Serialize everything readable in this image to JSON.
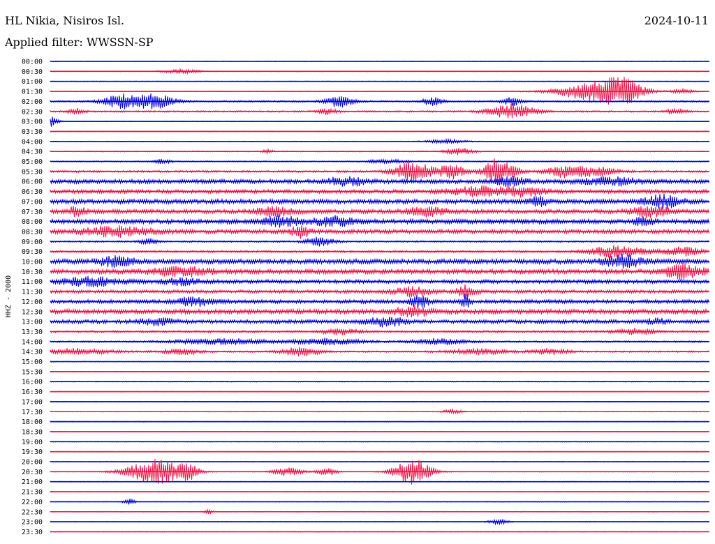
{
  "header": {
    "station": "HL Nikia, Nisiros Isl.",
    "date": "2024-10-11",
    "filter": "Applied filter: WWSSN-SP"
  },
  "chart_data": {
    "type": "line",
    "title": "HL Nikia, Nisiros Isl.",
    "ylabel": "HHZ - 2000",
    "colors": [
      "#0000dd",
      "#ee1144"
    ],
    "rows": [
      {
        "time": "00:00",
        "activity": 1
      },
      {
        "time": "00:30",
        "activity": 1,
        "bursts": [
          [
            0.2,
            1.5,
            0.02
          ]
        ]
      },
      {
        "time": "01:00",
        "activity": 1
      },
      {
        "time": "01:30",
        "activity": 1,
        "bursts": [
          [
            0.83,
            7,
            0.04
          ],
          [
            0.87,
            6,
            0.02
          ],
          [
            0.96,
            2,
            0.01
          ]
        ]
      },
      {
        "time": "02:00",
        "activity": 2,
        "bursts": [
          [
            0.11,
            5,
            0.02
          ],
          [
            0.16,
            5,
            0.02
          ],
          [
            0.44,
            4,
            0.015
          ],
          [
            0.58,
            3,
            0.01
          ],
          [
            0.7,
            3,
            0.01
          ]
        ]
      },
      {
        "time": "02:30",
        "activity": 2,
        "bursts": [
          [
            0.04,
            2,
            0.01
          ],
          [
            0.7,
            5,
            0.025
          ],
          [
            0.42,
            2,
            0.01
          ],
          [
            0.95,
            2,
            0.01
          ]
        ]
      },
      {
        "time": "03:00",
        "activity": 1,
        "bursts": [
          [
            0.0,
            4,
            0.008
          ]
        ]
      },
      {
        "time": "03:30",
        "activity": 1
      },
      {
        "time": "04:00",
        "activity": 1,
        "bursts": [
          [
            0.6,
            1.5,
            0.02
          ]
        ]
      },
      {
        "time": "04:30",
        "activity": 1.3,
        "bursts": [
          [
            0.62,
            2.5,
            0.015
          ],
          [
            0.33,
            1.5,
            0.005
          ]
        ]
      },
      {
        "time": "05:00",
        "activity": 1.5,
        "bursts": [
          [
            0.17,
            1.5,
            0.01
          ],
          [
            0.51,
            1.5,
            0.02
          ]
        ]
      },
      {
        "time": "05:30",
        "activity": 2.5,
        "bursts": [
          [
            0.55,
            7,
            0.02
          ],
          [
            0.61,
            5,
            0.015
          ],
          [
            0.67,
            6,
            0.01
          ],
          [
            0.69,
            6,
            0.015
          ],
          [
            0.78,
            4,
            0.02
          ],
          [
            0.83,
            3,
            0.02
          ]
        ]
      },
      {
        "time": "06:00",
        "activity": 5,
        "bursts": [
          [
            0.45,
            3,
            0.02
          ],
          [
            0.7,
            3,
            0.015
          ],
          [
            0.85,
            2.5,
            0.03
          ]
        ]
      },
      {
        "time": "06:30",
        "activity": 4.5,
        "bursts": [
          [
            0.65,
            3,
            0.03
          ],
          [
            0.72,
            3,
            0.02
          ]
        ]
      },
      {
        "time": "07:00",
        "activity": 5.5,
        "bursts": [
          [
            0.93,
            4,
            0.02
          ],
          [
            0.74,
            3,
            0.01
          ]
        ]
      },
      {
        "time": "07:30",
        "activity": 5,
        "bursts": [
          [
            0.04,
            3,
            0.01
          ],
          [
            0.34,
            3,
            0.02
          ],
          [
            0.57,
            3,
            0.02
          ],
          [
            0.91,
            4,
            0.02
          ]
        ]
      },
      {
        "time": "08:00",
        "activity": 5.5,
        "bursts": [
          [
            0.35,
            3,
            0.02
          ],
          [
            0.43,
            3,
            0.02
          ],
          [
            0.9,
            3,
            0.01
          ]
        ]
      },
      {
        "time": "08:30",
        "activity": 5,
        "bursts": [
          [
            0.1,
            3,
            0.04
          ],
          [
            0.38,
            4,
            0.01
          ]
        ]
      },
      {
        "time": "09:00",
        "activity": 2,
        "bursts": [
          [
            0.41,
            3,
            0.015
          ],
          [
            0.15,
            2,
            0.01
          ]
        ]
      },
      {
        "time": "09:30",
        "activity": 2.5,
        "bursts": [
          [
            0.86,
            4,
            0.03
          ],
          [
            0.96,
            3,
            0.02
          ]
        ]
      },
      {
        "time": "10:00",
        "activity": 6,
        "bursts": [
          [
            0.87,
            4,
            0.02
          ],
          [
            0.1,
            3,
            0.02
          ]
        ]
      },
      {
        "time": "10:30",
        "activity": 5.5,
        "bursts": [
          [
            0.96,
            5,
            0.02
          ],
          [
            0.2,
            3,
            0.03
          ]
        ]
      },
      {
        "time": "11:00",
        "activity": 4.5,
        "bursts": [
          [
            0.06,
            3,
            0.03
          ],
          [
            0.2,
            2,
            0.02
          ]
        ]
      },
      {
        "time": "11:30",
        "activity": 4,
        "bursts": [
          [
            0.55,
            3,
            0.02
          ],
          [
            0.63,
            4,
            0.01
          ]
        ]
      },
      {
        "time": "12:00",
        "activity": 4.5,
        "bursts": [
          [
            0.22,
            3,
            0.02
          ],
          [
            0.56,
            4,
            0.01
          ],
          [
            0.63,
            5,
            0.005
          ]
        ]
      },
      {
        "time": "12:30",
        "activity": 5.5,
        "bursts": [
          [
            0.55,
            3,
            0.02
          ]
        ]
      },
      {
        "time": "13:00",
        "activity": 4.5,
        "bursts": [
          [
            0.16,
            2,
            0.02
          ],
          [
            0.51,
            3,
            0.02
          ],
          [
            0.92,
            2,
            0.01
          ]
        ]
      },
      {
        "time": "13:30",
        "activity": 2.5,
        "bursts": [
          [
            0.44,
            2,
            0.02
          ],
          [
            0.89,
            2,
            0.02
          ]
        ]
      },
      {
        "time": "14:00",
        "activity": 2,
        "bursts": [
          [
            0.26,
            2,
            0.05
          ],
          [
            0.42,
            2,
            0.04
          ],
          [
            0.59,
            2,
            0.03
          ]
        ]
      },
      {
        "time": "14:30",
        "activity": 2,
        "bursts": [
          [
            0.04,
            2,
            0.04
          ],
          [
            0.2,
            2,
            0.02
          ],
          [
            0.38,
            3,
            0.02
          ],
          [
            0.65,
            2,
            0.03
          ],
          [
            0.76,
            2,
            0.02
          ]
        ]
      },
      {
        "time": "15:00",
        "activity": 1
      },
      {
        "time": "15:30",
        "activity": 1
      },
      {
        "time": "16:00",
        "activity": 1.2
      },
      {
        "time": "16:30",
        "activity": 1
      },
      {
        "time": "17:00",
        "activity": 1
      },
      {
        "time": "17:30",
        "activity": 1,
        "bursts": [
          [
            0.61,
            1.5,
            0.01
          ]
        ]
      },
      {
        "time": "18:00",
        "activity": 1
      },
      {
        "time": "18:30",
        "activity": 1
      },
      {
        "time": "19:00",
        "activity": 1
      },
      {
        "time": "19:30",
        "activity": 1
      },
      {
        "time": "20:00",
        "activity": 1
      },
      {
        "time": "20:30",
        "activity": 1,
        "bursts": [
          [
            0.16,
            9,
            0.03
          ],
          [
            0.21,
            5,
            0.01
          ],
          [
            0.36,
            3,
            0.015
          ],
          [
            0.42,
            3,
            0.01
          ],
          [
            0.55,
            9,
            0.02
          ]
        ]
      },
      {
        "time": "21:00",
        "activity": 1
      },
      {
        "time": "21:30",
        "activity": 1
      },
      {
        "time": "22:00",
        "activity": 1,
        "bursts": [
          [
            0.12,
            3,
            0.005
          ]
        ]
      },
      {
        "time": "22:30",
        "activity": 1,
        "bursts": [
          [
            0.24,
            1.5,
            0.005
          ]
        ]
      },
      {
        "time": "23:00",
        "activity": 1,
        "bursts": [
          [
            0.68,
            2,
            0.01
          ]
        ]
      },
      {
        "time": "23:30",
        "activity": 1
      }
    ]
  }
}
